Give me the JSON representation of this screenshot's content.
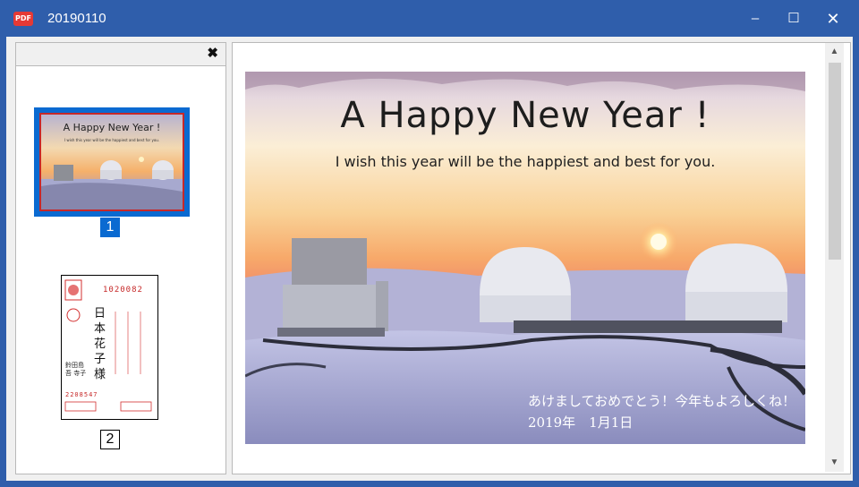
{
  "window": {
    "app_icon_label": "PDF",
    "title": "20190110",
    "minimize_glyph": "‒",
    "maximize_glyph": "☐",
    "close_glyph": "✕"
  },
  "sidebar": {
    "close_glyph": "✖",
    "thumbnails": [
      {
        "page_number": "1",
        "selected": true,
        "title": "A Happy New Year !",
        "subtitle": "I wish this year will be the happiest and best for you."
      },
      {
        "page_number": "2",
        "selected": false,
        "postal_code": "1020082",
        "recipient": "日本 花子 様",
        "sender": "鈴田島 吾 寺子",
        "sender_code": "2208547"
      }
    ]
  },
  "document": {
    "card_title": "A Happy New Year !",
    "card_subtitle": "I wish this year will be the happiest and best for you.",
    "greeting_jp": "あけましておめでとう！今年もよろしくね！",
    "date_jp": "2019年　1月1日"
  },
  "scrollbar": {
    "up_glyph": "▲",
    "down_glyph": "▼"
  },
  "colors": {
    "titlebar": "#2f5eab",
    "selection": "#0a6ad1",
    "thumb_border": "#c62828"
  }
}
